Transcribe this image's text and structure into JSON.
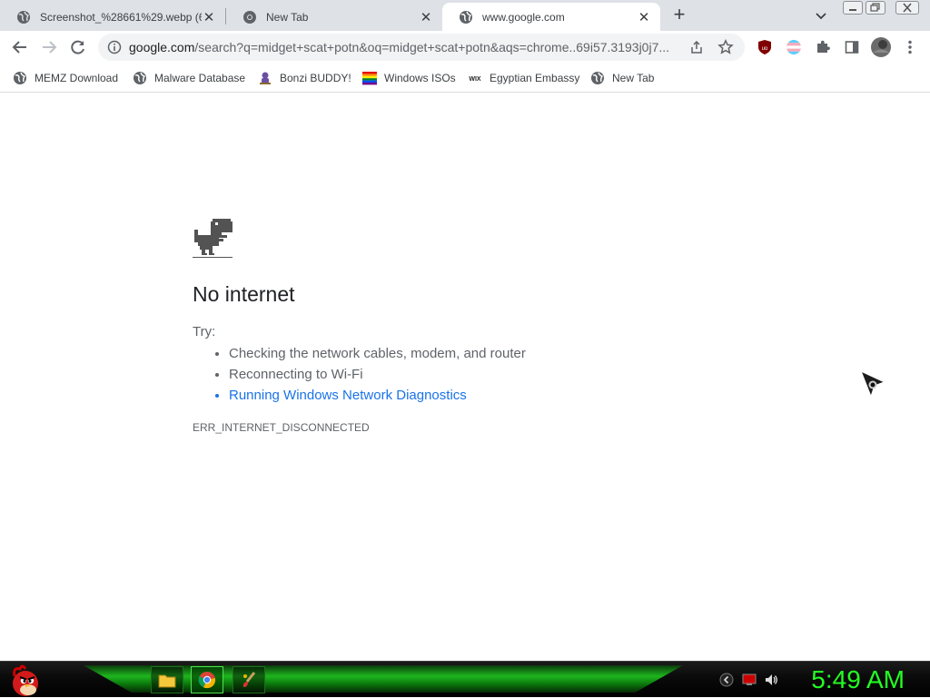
{
  "tabs": [
    {
      "title": "Screenshot_%28661%29.webp (6",
      "active": false
    },
    {
      "title": "New Tab",
      "active": false
    },
    {
      "title": "www.google.com",
      "active": true
    }
  ],
  "new_tab_symbol": "+",
  "close_symbol": "✕",
  "omnibox": {
    "domain": "google.com",
    "path": "/search?q=midget+scat+potn&oq=midget+scat+potn&aqs=chrome..69i57.3193j0j7..."
  },
  "bookmarks": [
    {
      "label": "MEMZ Download",
      "icon": "globe-icon"
    },
    {
      "label": "Malware Database",
      "icon": "globe-icon"
    },
    {
      "label": "Bonzi BUDDY!",
      "icon": "bonzi-icon"
    },
    {
      "label": "Windows ISOs",
      "icon": "rainbow-flag-icon"
    },
    {
      "label": "Egyptian Embassy",
      "icon": "wix-icon"
    },
    {
      "label": "New Tab",
      "icon": "globe-icon"
    }
  ],
  "error_page": {
    "title": "No internet",
    "try_label": "Try:",
    "suggestions": [
      "Checking the network cables, modem, and router",
      "Reconnecting to Wi-Fi",
      "Running Windows Network Diagnostics"
    ],
    "error_code": "ERR_INTERNET_DISCONNECTED"
  },
  "taskbar": {
    "clock": "5:49 AM",
    "accent": "#22ff22"
  },
  "colors": {
    "link": "#1a73e8",
    "tabstrip": "#dee1e6",
    "omnibox_bg": "#f1f3f4"
  }
}
